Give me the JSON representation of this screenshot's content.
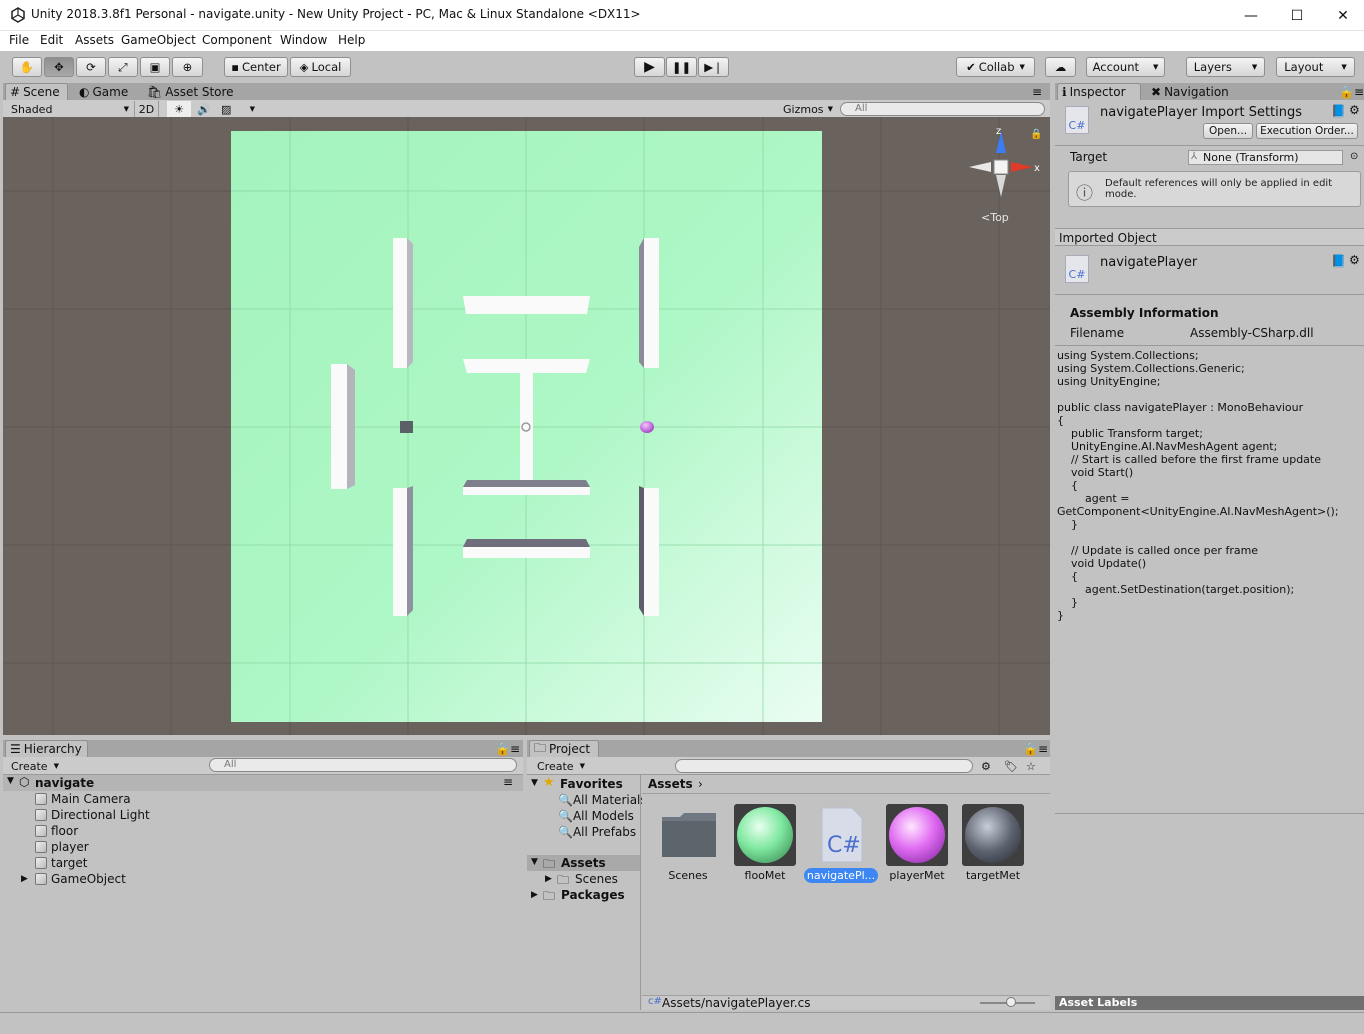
{
  "window": {
    "title": "Unity 2018.3.8f1 Personal - navigate.unity - New Unity Project - PC, Mac & Linux Standalone <DX11>",
    "minimize": "—",
    "maximize": "☐",
    "close": "✕"
  },
  "menu": [
    "File",
    "Edit",
    "Assets",
    "GameObject",
    "Component",
    "Window",
    "Help"
  ],
  "toolbar": {
    "pivot": "Center",
    "space": "Local",
    "collab": "Collab",
    "account": "Account",
    "layers": "Layers",
    "layout": "Layout"
  },
  "scene_tabs": [
    "Scene",
    "Game",
    "Asset Store"
  ],
  "scene_bar": {
    "shading": "Shaded",
    "mode2d": "2D",
    "gizmos": "Gizmos",
    "search_placeholder": "All"
  },
  "gizmo": {
    "axis_z": "z",
    "axis_x": "x",
    "view": "Top"
  },
  "hierarchy": {
    "tab": "Hierarchy",
    "create": "Create",
    "search_placeholder": "All",
    "scene": "navigate",
    "items": [
      "Main Camera",
      "Directional Light",
      "floor",
      "player",
      "target",
      "GameObject"
    ]
  },
  "project": {
    "tab": "Project",
    "create": "Create",
    "favorites_label": "Favorites",
    "favorites": [
      "All Materials",
      "All Models",
      "All Prefabs"
    ],
    "assets_label": "Assets",
    "scenes_label": "Scenes",
    "packages_label": "Packages",
    "breadcrumb": "Assets",
    "assets": [
      "Scenes",
      "flooMet",
      "navigatePl...",
      "playerMet",
      "targetMet"
    ],
    "status_path": "Assets/navigatePlayer.cs"
  },
  "inspector": {
    "tabs": [
      "Inspector",
      "Navigation"
    ],
    "title": "navigatePlayer Import Settings",
    "open": "Open...",
    "execution_order": "Execution Order...",
    "target_label": "Target",
    "target_value": "None (Transform)",
    "help_text": "Default references will only be applied in edit mode.",
    "imported_object": "Imported Object",
    "object_name": "navigatePlayer",
    "cs_label": "C#",
    "assembly_info": "Assembly Information",
    "filename_label": "Filename",
    "filename_value": "Assembly-CSharp.dll",
    "code": "using System.Collections;\nusing System.Collections.Generic;\nusing UnityEngine;\n\npublic class navigatePlayer : MonoBehaviour\n{\n    public Transform target;\n    UnityEngine.AI.NavMeshAgent agent;\n    // Start is called before the first frame update\n    void Start()\n    {\n        agent =\nGetComponent<UnityEngine.AI.NavMeshAgent>();\n    }\n\n    // Update is called once per frame\n    void Update()\n    {\n        agent.SetDestination(target.position);\n    }\n}",
    "asset_labels": "Asset Labels"
  },
  "colors": {
    "floor": "#a6f5bf",
    "background": "#6a625c",
    "player": "#d864f0",
    "selection": "#3d87f5"
  }
}
